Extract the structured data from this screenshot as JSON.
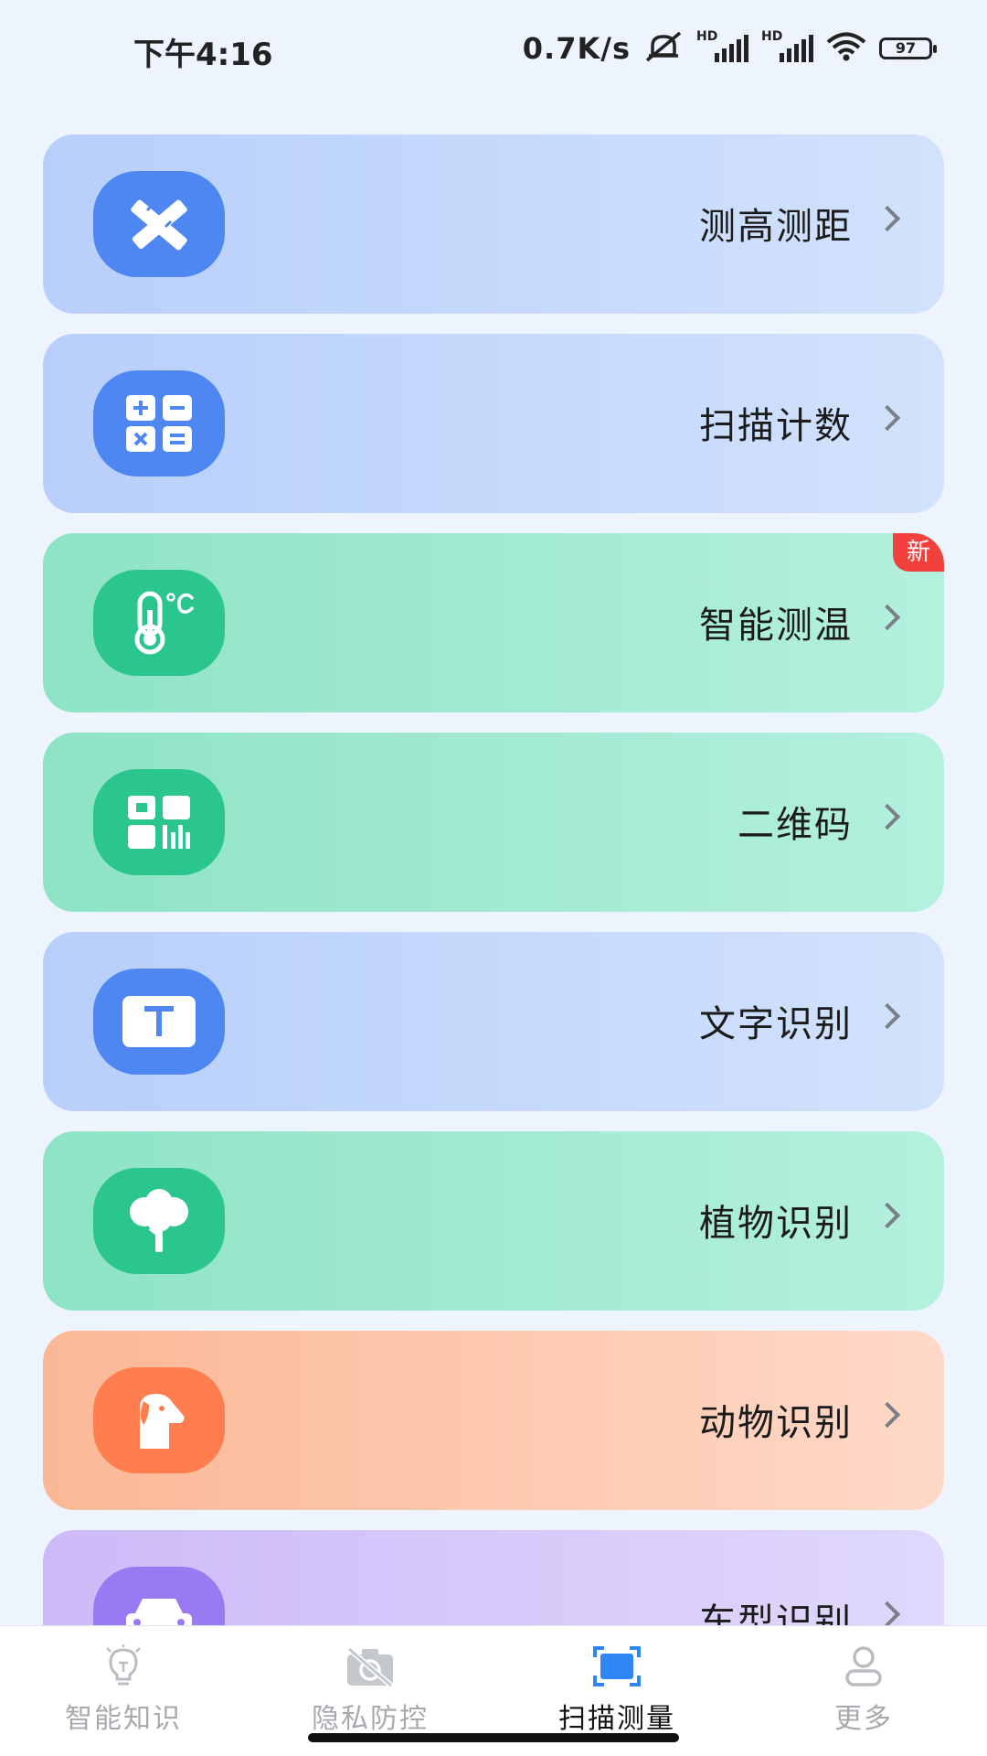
{
  "status_bar": {
    "time": "下午4:16",
    "net_speed": "0.7K/s",
    "battery": "97",
    "icons": [
      "mute-icon",
      "signal-hd-icon",
      "signal-hd-icon",
      "wifi-icon",
      "battery-icon"
    ]
  },
  "features": [
    {
      "label": "测高测距",
      "icon": "pencil-ruler-icon",
      "theme": "blue"
    },
    {
      "label": "扫描计数",
      "icon": "calculator-icon",
      "theme": "blue"
    },
    {
      "label": "智能测温",
      "icon": "thermometer-icon",
      "theme": "green",
      "badge": "新"
    },
    {
      "label": "二维码",
      "icon": "qr-code-icon",
      "theme": "green"
    },
    {
      "label": "文字识别",
      "icon": "text-t-icon",
      "theme": "blue"
    },
    {
      "label": "植物识别",
      "icon": "tree-icon",
      "theme": "green"
    },
    {
      "label": "动物识别",
      "icon": "dog-icon",
      "theme": "orange"
    },
    {
      "label": "车型识别",
      "icon": "car-icon",
      "theme": "purple"
    }
  ],
  "bottom_nav": {
    "items": [
      {
        "label": "智能知识",
        "icon": "lightbulb-icon",
        "active": false
      },
      {
        "label": "隐私防控",
        "icon": "camera-off-icon",
        "active": false
      },
      {
        "label": "扫描测量",
        "icon": "scan-icon",
        "active": true
      },
      {
        "label": "更多",
        "icon": "person-icon",
        "active": false
      }
    ]
  },
  "colors": {
    "background": "#eef4fd",
    "accent": "#2e86f5",
    "badge": "#f2413c"
  }
}
